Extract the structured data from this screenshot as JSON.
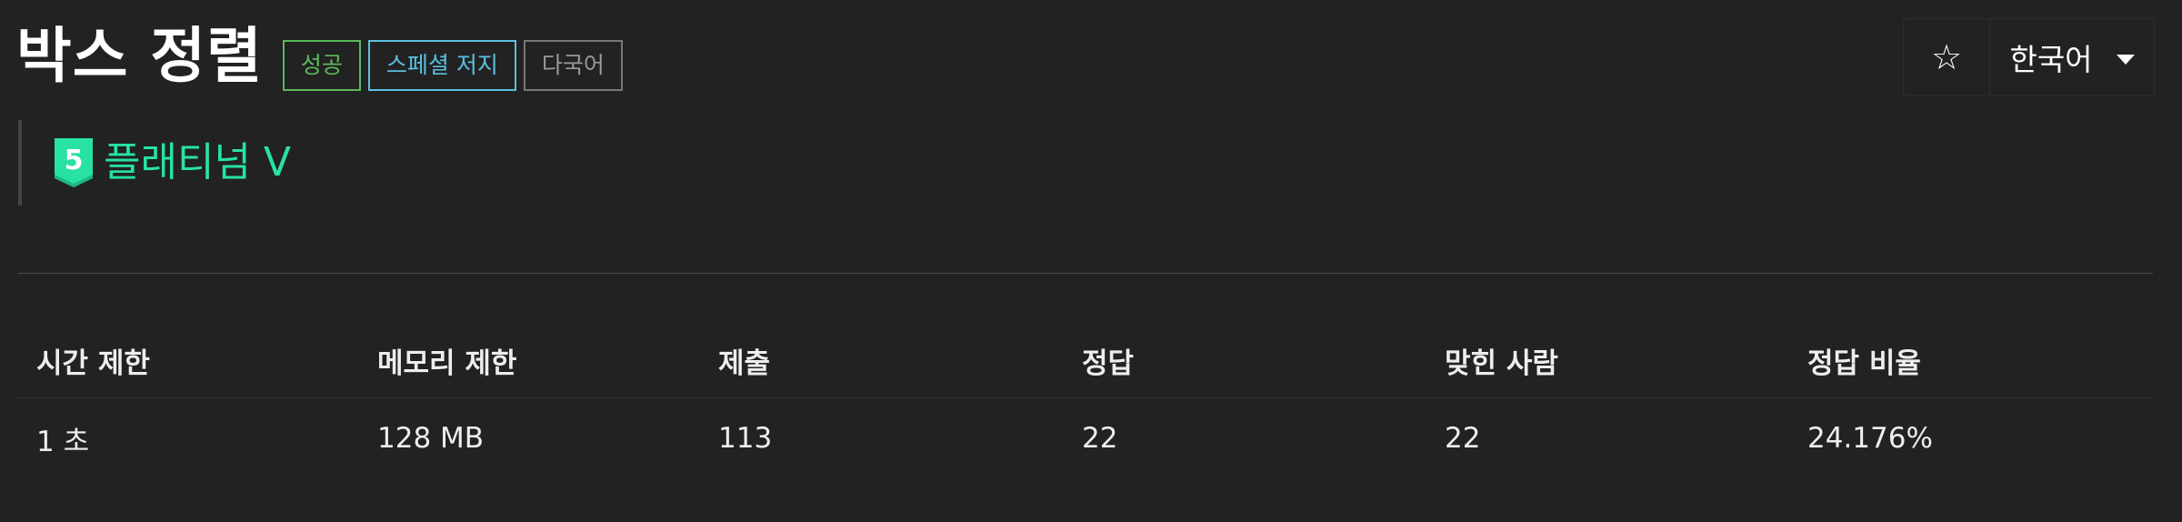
{
  "problem": {
    "title": "박스 정렬",
    "badges": {
      "success": "성공",
      "special_judge": "스페셜 저지",
      "multilingual": "다국어"
    }
  },
  "controls": {
    "star_glyph": "☆",
    "language": "한국어"
  },
  "tier": {
    "level": "5",
    "label": "플래티넘 V",
    "color": "#27e2a4"
  },
  "info_table": {
    "headers": {
      "time_limit": "시간 제한",
      "memory_limit": "메모리 제한",
      "submissions": "제출",
      "accepted": "정답",
      "solved_users": "맞힌 사람",
      "accept_ratio": "정답 비율"
    },
    "values": {
      "time_limit": "1 초",
      "memory_limit": "128 MB",
      "submissions": "113",
      "accepted": "22",
      "solved_users": "22",
      "accept_ratio": "24.176%"
    }
  }
}
